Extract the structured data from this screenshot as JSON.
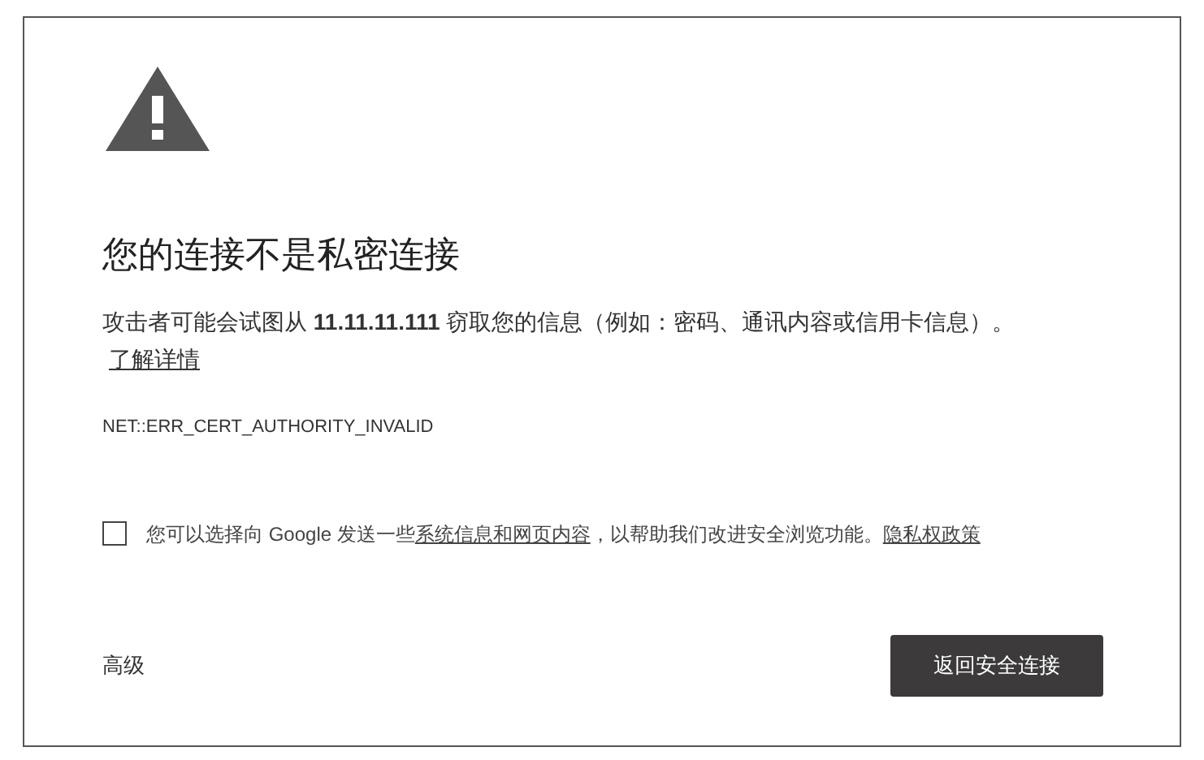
{
  "heading": "您的连接不是私密连接",
  "description": {
    "text": "攻击者可能会试图从 **11.11.11.111** 窃取您的信息（例如：密码、通讯内容或信用卡信息）。",
    "link": "了解详情"
  },
  "error_code": "NET::ERR_CERT_AUTHORITY_INVALID",
  "report_option": {
    "checked": false,
    "segments": [
      {
        "kind": "text",
        "text": "您可以选择向 Google 发送一些"
      },
      {
        "kind": "link",
        "text": "系统信息和网页内容"
      },
      {
        "kind": "text",
        "text": "，以帮助我们改进安全浏览功能。"
      },
      {
        "kind": "link",
        "text": "隐私权政策"
      }
    ]
  },
  "advanced_button": "高级",
  "back_button": "返回安全连接"
}
